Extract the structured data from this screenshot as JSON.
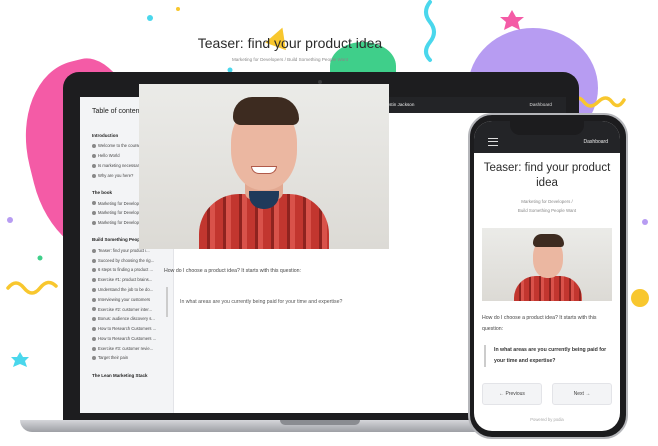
{
  "colors": {
    "pink": "#f45ba6",
    "purple": "#b79cf2",
    "green": "#3fcf8a",
    "yellow": "#f8c72e",
    "cyan": "#4ad7ec",
    "topbar": "#232427"
  },
  "laptop": {
    "sidebar": {
      "title": "Table of contents",
      "sections": [
        {
          "heading": "Introduction",
          "items": [
            "Welcome to the course!",
            "Hello World",
            "Is marketing necessary?",
            "Why are you here?"
          ]
        },
        {
          "heading": "The book",
          "items": [
            "Marketing for Developers - ...",
            "Marketing for Developers - ...",
            "Marketing for Developers - ..."
          ]
        },
        {
          "heading": "Build Something People Want",
          "items": [
            "Teaser: find your product i...",
            "Succeed by choosing the rig...",
            "6 steps to finding a product ...",
            "Exercise #1: product brains...",
            "Understand the job to be do...",
            "Interviewing your customers",
            "Exercise #2: customer inter...",
            "Bonus: audience discovery s...",
            "How to Research Customers ...",
            "How to Research Customers ...",
            "Exercise #3: customer revie...",
            "Target their pain"
          ]
        },
        {
          "heading": "The Lean Marketing Stack",
          "items": []
        }
      ]
    },
    "topbar": {
      "title": "Marketing for Developers by Justin Jackson",
      "dashboard_label": "Dashboard"
    },
    "lesson": {
      "title": "Teaser: find your product idea",
      "breadcrumb": "Marketing for Developers  /  Build Something People Want",
      "question": "How do I choose a product idea? It starts with this question:",
      "quote": "In what areas are you currently being paid for your time and expertise?"
    }
  },
  "phone": {
    "dashboard_label": "Dashboard",
    "title": "Teaser: find your product idea",
    "breadcrumb_line1": "Marketing for Developers  /",
    "breadcrumb_line2": "Build Something People Want",
    "question": "How do I choose a product idea? It starts with this question:",
    "quote": "In what areas are you currently being paid for your time and expertise?",
    "prev_label": "← Previous",
    "next_label": "Next →",
    "powered": "Powered by podia"
  }
}
